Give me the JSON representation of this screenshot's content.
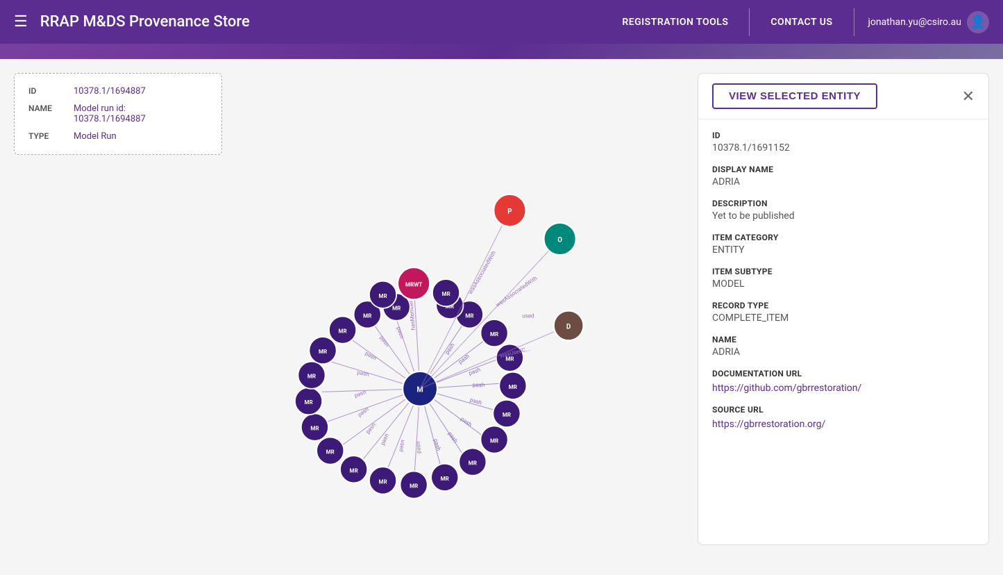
{
  "header": {
    "title": "RRAP M&DS Provenance Store",
    "nav": [
      {
        "label": "REGISTRATION TOOLS",
        "id": "registration-tools"
      },
      {
        "label": "CONTACT US",
        "id": "contact-us"
      }
    ],
    "user_email": "jonathan.yu@csiro.au"
  },
  "info_card": {
    "id_label": "ID",
    "id_value": "10378.1/1694887",
    "name_label": "NAME",
    "name_value": "Model run id:\n10378.1/1694887",
    "type_label": "TYPE",
    "type_value": "Model Run"
  },
  "right_panel": {
    "view_entity_label": "VIEW SELECTED ENTITY",
    "id_label": "ID",
    "id_value": "10378.1/1691152",
    "display_name_label": "DISPLAY NAME",
    "display_name_value": "ADRIA",
    "description_label": "DESCRIPTION",
    "description_value": "Yet to be published",
    "item_category_label": "ITEM CATEGORY",
    "item_category_value": "ENTITY",
    "item_subtype_label": "ITEM SUBTYPE",
    "item_subtype_value": "MODEL",
    "record_type_label": "RECORD TYPE",
    "record_type_value": "COMPLETE_ITEM",
    "name_label": "NAME",
    "name_value": "ADRIA",
    "documentation_url_label": "DOCUMENTATION URL",
    "documentation_url_value": "https://github.com/gbrrestoration/",
    "source_url_label": "SOURCE URL",
    "source_url_value": "https://gbrrestoration.org/"
  }
}
